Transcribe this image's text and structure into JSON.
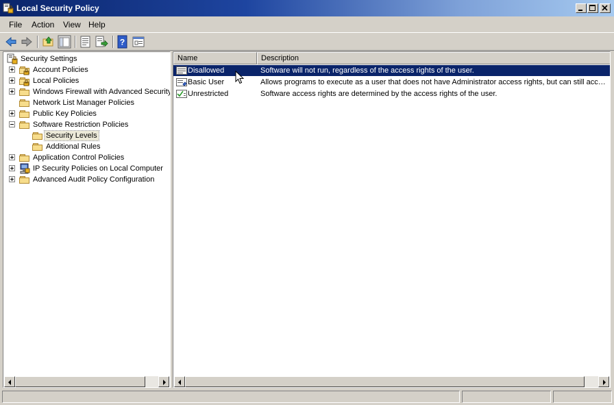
{
  "window": {
    "title": "Local Security Policy"
  },
  "menu": [
    "File",
    "Action",
    "View",
    "Help"
  ],
  "toolbar": {
    "buttons": [
      "back-icon",
      "forward-icon",
      "up-folder-icon",
      "show-hide-tree-icon",
      "properties-icon",
      "export-list-icon",
      "help-icon",
      "console-view-icon"
    ]
  },
  "tree": {
    "root": "Security Settings",
    "items": [
      {
        "label": "Account Policies",
        "expand": "plus",
        "icon": "policy-folder-icon"
      },
      {
        "label": "Local Policies",
        "expand": "plus",
        "icon": "policy-folder-icon"
      },
      {
        "label": "Windows Firewall with Advanced Security",
        "expand": "plus",
        "icon": "folder-icon"
      },
      {
        "label": "Network List Manager Policies",
        "expand": "none",
        "icon": "folder-icon"
      },
      {
        "label": "Public Key Policies",
        "expand": "plus",
        "icon": "folder-icon"
      },
      {
        "label": "Software Restriction Policies",
        "expand": "minus",
        "icon": "folder-icon"
      },
      {
        "label": "Security Levels",
        "expand": "none",
        "icon": "folder-icon",
        "indent": 1,
        "selected": true
      },
      {
        "label": "Additional Rules",
        "expand": "none",
        "icon": "folder-icon",
        "indent": 1
      },
      {
        "label": "Application Control Policies",
        "expand": "plus",
        "icon": "folder-icon"
      },
      {
        "label": "IP Security Policies on Local Computer",
        "expand": "plus",
        "icon": "ipsec-computer-icon"
      },
      {
        "label": "Advanced Audit Policy Configuration",
        "expand": "plus",
        "icon": "folder-icon"
      }
    ]
  },
  "list": {
    "columns": [
      "Name",
      "Description"
    ],
    "rows": [
      {
        "name": "Disallowed",
        "description": "Software will not run, regardless of the access rights of the user.",
        "selected": true
      },
      {
        "name": "Basic User",
        "description": "Allows programs to execute as a user that does not have Administrator access rights, but can still acce…"
      },
      {
        "name": "Unrestricted",
        "description": "Software access rights are determined by the access rights of the user."
      }
    ]
  },
  "colors": {
    "selection": "#0a246a",
    "titlebar_start": "#0a246a",
    "titlebar_end": "#a6caf0"
  }
}
